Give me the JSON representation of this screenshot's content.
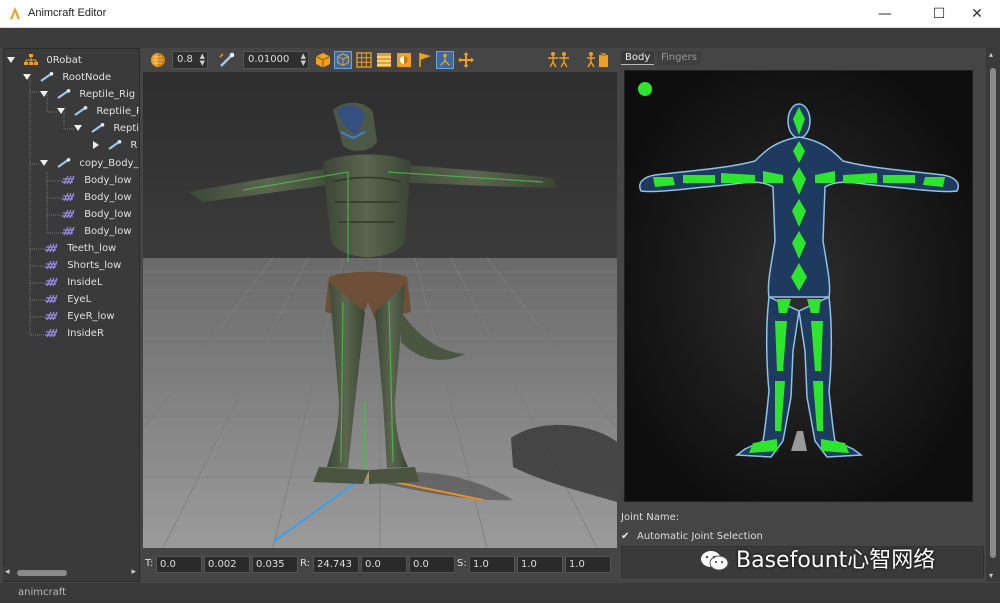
{
  "window": {
    "title": "Animcraft Editor",
    "minimize_glyph": "—",
    "maximize_glyph": "☐",
    "close_glyph": "✕"
  },
  "outliner": {
    "items": [
      {
        "label": "0Robat",
        "icon": "hierarchy-icon",
        "expanded": true
      },
      {
        "label": "RootNode",
        "icon": "bone-icon",
        "expanded": true
      },
      {
        "label": "Reptile_Rig",
        "icon": "bone-icon",
        "expanded": true
      },
      {
        "label": "Reptile_R",
        "icon": "bone-icon",
        "expanded": true
      },
      {
        "label": "Repti",
        "icon": "bone-icon",
        "expanded": true
      },
      {
        "label": "R",
        "icon": "bone-icon",
        "expanded": false
      },
      {
        "label": "copy_Body_l",
        "icon": "bone-icon",
        "expanded": true
      },
      {
        "label": "Body_low",
        "icon": "mesh-icon"
      },
      {
        "label": "Body_low",
        "icon": "mesh-icon"
      },
      {
        "label": "Body_low",
        "icon": "mesh-icon"
      },
      {
        "label": "Body_low",
        "icon": "mesh-icon"
      },
      {
        "label": "Teeth_low",
        "icon": "mesh-icon"
      },
      {
        "label": "Shorts_low",
        "icon": "mesh-icon"
      },
      {
        "label": "InsideL",
        "icon": "mesh-icon"
      },
      {
        "label": "EyeL",
        "icon": "mesh-icon"
      },
      {
        "label": "EyeR_low",
        "icon": "mesh-icon"
      },
      {
        "label": "InsideR",
        "icon": "mesh-icon"
      }
    ]
  },
  "toolbar": {
    "opacity_value": "0.8",
    "scale_value": "0.01000"
  },
  "transform": {
    "t_label": "T:",
    "t": [
      "0.0",
      "0.002",
      "0.035"
    ],
    "r_label": "R:",
    "r": [
      "24.743",
      "0.0",
      "0.0"
    ],
    "s_label": "S:",
    "s": [
      "1.0",
      "1.0",
      "1.0"
    ]
  },
  "right_panel": {
    "tabs": [
      "Body",
      "Fingers"
    ],
    "joint_name_label": "Joint Name:",
    "auto_joint_label": "Automatic Joint Selection",
    "auto_joint_checked": true
  },
  "status": {
    "text": "animcraft"
  },
  "watermark": {
    "text": "Basefount心智网络"
  },
  "colors": {
    "accent_green": "#2ee52e",
    "body_blue": "#1e3a5f",
    "outline_blue": "#8ec3e6",
    "toolbar_orange": "#f0a020"
  }
}
